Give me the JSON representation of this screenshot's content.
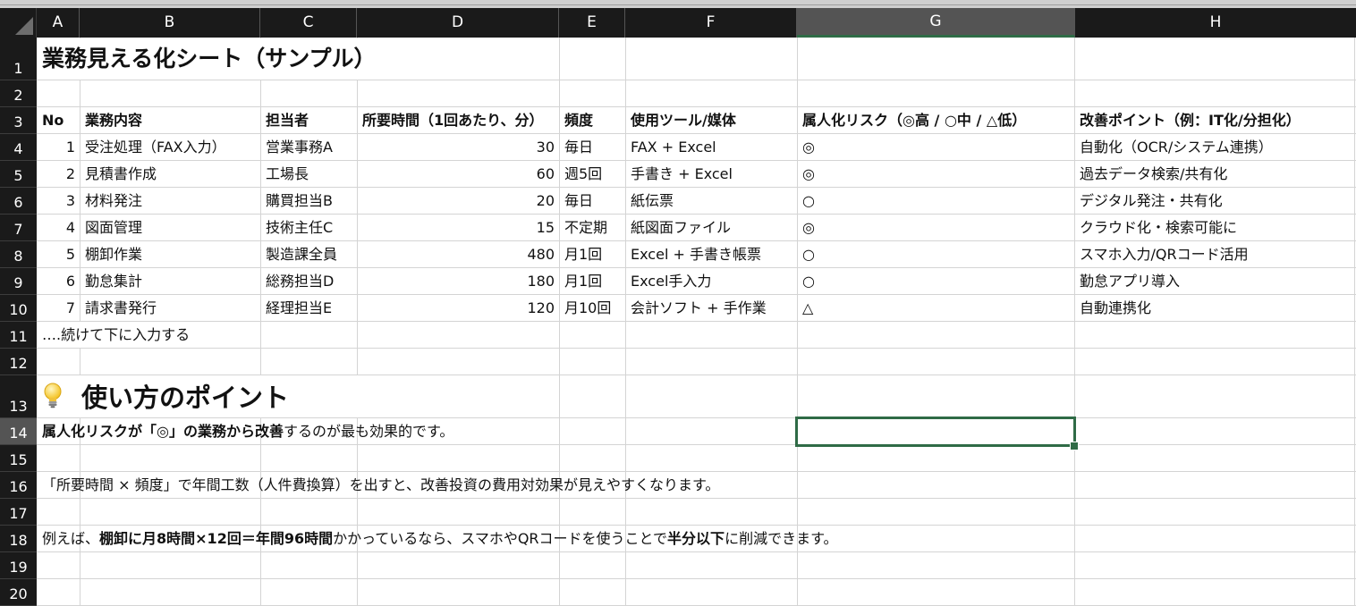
{
  "columns": [
    "A",
    "B",
    "C",
    "D",
    "E",
    "F",
    "G",
    "H"
  ],
  "rows": [
    "1",
    "2",
    "3",
    "4",
    "5",
    "6",
    "7",
    "8",
    "9",
    "10",
    "11",
    "12",
    "13",
    "14",
    "15",
    "16",
    "17",
    "18",
    "19",
    "20"
  ],
  "selected_column": "G",
  "selected_row": "14",
  "sheet": {
    "title": "業務見える化シート（サンプル）",
    "headers": {
      "no": "No",
      "task": "業務内容",
      "owner": "担当者",
      "time": "所要時間（1回あたり、分）",
      "frequency": "頻度",
      "tools": "使用ツール/媒体",
      "risk": "属人化リスク（◎高 / ○中 / △低）",
      "improvement": "改善ポイント（例：IT化/分担化）"
    },
    "records": [
      {
        "no": "1",
        "task": "受注処理（FAX入力）",
        "owner": "営業事務A",
        "time": "30",
        "frequency": "毎日",
        "tools": "FAX + Excel",
        "risk": "◎",
        "improvement": "自動化（OCR/システム連携）"
      },
      {
        "no": "2",
        "task": "見積書作成",
        "owner": "工場長",
        "time": "60",
        "frequency": "週5回",
        "tools": "手書き + Excel",
        "risk": "◎",
        "improvement": "過去データ検索/共有化"
      },
      {
        "no": "3",
        "task": "材料発注",
        "owner": "購買担当B",
        "time": "20",
        "frequency": "毎日",
        "tools": "紙伝票",
        "risk": "○",
        "improvement": "デジタル発注・共有化"
      },
      {
        "no": "4",
        "task": "図面管理",
        "owner": "技術主任C",
        "time": "15",
        "frequency": "不定期",
        "tools": "紙図面ファイル",
        "risk": "◎",
        "improvement": "クラウド化・検索可能に"
      },
      {
        "no": "5",
        "task": "棚卸作業",
        "owner": "製造課全員",
        "time": "480",
        "frequency": "月1回",
        "tools": "Excel + 手書き帳票",
        "risk": "○",
        "improvement": "スマホ入力/QRコード活用"
      },
      {
        "no": "6",
        "task": "勤怠集計",
        "owner": "総務担当D",
        "time": "180",
        "frequency": "月1回",
        "tools": "Excel手入力",
        "risk": "○",
        "improvement": "勤怠アプリ導入"
      },
      {
        "no": "7",
        "task": "請求書発行",
        "owner": "経理担当E",
        "time": "120",
        "frequency": "月10回",
        "tools": "会計ソフト + 手作業",
        "risk": "△",
        "improvement": "自動連携化"
      }
    ],
    "continue_note": "….続けて下に入力する",
    "tips_title": "使い方のポイント",
    "tips_icon": "lightbulb-icon",
    "tip1": {
      "bold1": "属人化リスクが",
      "plain1": "「◎」",
      "bold2": "の業務から改善",
      "plain2": "するのが最も効果的です。"
    },
    "tip2": "「所要時間 × 頻度」で年間工数（人件費換算）を出すと、改善投資の費用対効果が見えやすくなります。",
    "tip3": {
      "plain1": "例えば、",
      "bold1": "棚卸に月8時間×12回＝年間96時間",
      "plain2": "かかっているなら、スマホやQRコードを使うことで",
      "bold2": "半分以下",
      "plain3": "に削減できます。"
    }
  },
  "colors": {
    "selection": "#2f6b46",
    "header_bg": "#1a1a1a",
    "selected_header_bg": "#545454",
    "gridline": "#d4d4d4"
  }
}
